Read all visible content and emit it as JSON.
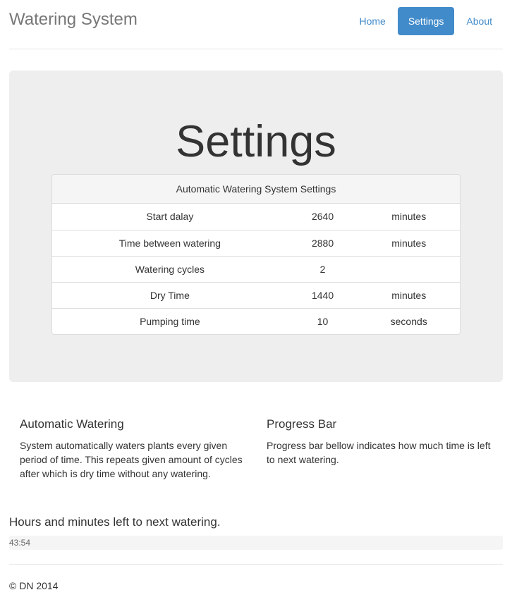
{
  "brand": "Watering System",
  "nav": {
    "home": "Home",
    "settings": "Settings",
    "about": "About"
  },
  "jumbotron": {
    "title": "Settings"
  },
  "settings_panel": {
    "heading": "Automatic Watering System Settings",
    "rows": [
      {
        "label": "Start dalay",
        "value": "2640",
        "unit": "minutes"
      },
      {
        "label": "Time between watering",
        "value": "2880",
        "unit": "minutes"
      },
      {
        "label": "Watering cycles",
        "value": "2",
        "unit": ""
      },
      {
        "label": "Dry Time",
        "value": "1440",
        "unit": "minutes"
      },
      {
        "label": "Pumping time",
        "value": "10",
        "unit": "seconds"
      }
    ]
  },
  "info": {
    "auto_title": "Automatic Watering",
    "auto_text": "System automatically waters plants every given period of time. This repeats given amount of cycles after which is dry time without any watering.",
    "progress_title": "Progress Bar",
    "progress_text": "Progress bar bellow indicates how much time is left to next watering."
  },
  "progress": {
    "title": "Hours and minutes left to next watering.",
    "value_text": "43:54"
  },
  "footer": "© DN 2014"
}
